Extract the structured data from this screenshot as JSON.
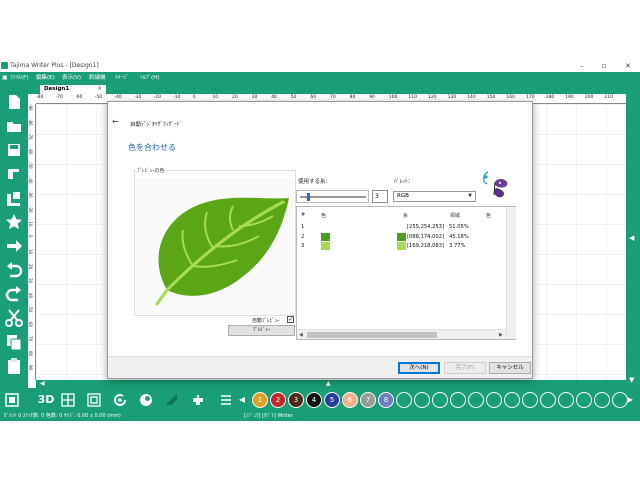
{
  "window": {
    "title": "Tajima Writer Plus - [Design1]",
    "controls": [
      "–",
      "▫",
      "✕"
    ]
  },
  "menu": {
    "items": [
      "ﾌｧｲﾙ(F)",
      "編集(E)",
      "表示(V)",
      "刺繍機",
      "ｲﾒｰｼﾞ",
      "ﾍﾙﾌﾟ(H)"
    ]
  },
  "document_tab": {
    "label": "Design1",
    "close": "✕"
  },
  "ruler": {
    "top": [
      "-80",
      "-70",
      "-60",
      "-50",
      "-40",
      "-30",
      "-20",
      "-10",
      "0",
      "10",
      "20",
      "30",
      "40",
      "50",
      "60",
      "70",
      "80",
      "90",
      "100",
      "110",
      "120",
      "130",
      "140",
      "150",
      "160",
      "170",
      "180",
      "190",
      "200",
      "210"
    ],
    "left": [
      "-90",
      "-80",
      "-70",
      "-60",
      "-50",
      "-40",
      "-30",
      "-20",
      "-10",
      "0",
      "10",
      "20",
      "30",
      "40",
      "50",
      "60",
      "70",
      "80",
      "90"
    ]
  },
  "bottom_toolbar": {
    "label_3d": "3D",
    "swatches": [
      {
        "num": "1",
        "color": "#d9a224"
      },
      {
        "num": "2",
        "color": "#c5282b"
      },
      {
        "num": "3",
        "color": "#4a2a1a"
      },
      {
        "num": "4",
        "color": "#111111"
      },
      {
        "num": "5",
        "color": "#2a3d9a"
      },
      {
        "num": "6",
        "color": "#f0b08a"
      },
      {
        "num": "7",
        "color": "#9a9a9a"
      },
      {
        "num": "8",
        "color": "#6a7fbf"
      },
      {
        "num": "",
        "color": "#1a9e78"
      },
      {
        "num": "",
        "color": "#1a9e78"
      },
      {
        "num": "",
        "color": "#1a9e78"
      },
      {
        "num": "",
        "color": "#1a9e78"
      },
      {
        "num": "",
        "color": "#1a9e78"
      },
      {
        "num": "",
        "color": "#1a9e78"
      },
      {
        "num": "",
        "color": "#1a9e78"
      },
      {
        "num": "",
        "color": "#1a9e78"
      },
      {
        "num": "",
        "color": "#1a9e78"
      },
      {
        "num": "",
        "color": "#1a9e78"
      },
      {
        "num": "",
        "color": "#1a9e78"
      },
      {
        "num": "",
        "color": "#1a9e78"
      },
      {
        "num": "",
        "color": "#1a9e78"
      }
    ]
  },
  "statusbar": {
    "left": "ｾﾞﾒﾝﾄ 0 ｽﾃｯﾁ数: 0 色数: 0 ｻｲｽﾞ: 0.00 x 0.00 (mm)",
    "right": "[ｼｼﾞｭｳ] [ﾀｼﾞﾏ] Writer"
  },
  "dialog": {
    "title": "自動ﾃﾞｼﾞﾀｲｻﾞｳｨｻﾞｰﾄﾞ",
    "heading": "色を合わせる",
    "preview_label": "ﾌﾟﾚﾋﾞｭｰの色",
    "auto_preview_label": "自動ﾌﾟﾚﾋﾞｭｰ",
    "auto_preview_checked": "✓",
    "preview_button": "ﾌﾟﾚﾋﾞｭｰ",
    "colors_label": "使用する糸：",
    "color_count": "3",
    "color_slider_fraction": 0.1,
    "palette_label": "ﾊﾟﾚｯﾄ：",
    "palette_value": "RGB",
    "table": {
      "headers": [
        "#",
        "色",
        "糸",
        "領域",
        "色"
      ],
      "rows": [
        {
          "index": "1",
          "swatch": "",
          "thread_swatch": "",
          "rgb": "[255,254,253]",
          "area": "51.05%"
        },
        {
          "index": "2",
          "swatch": "#4f9e1c",
          "thread_swatch": "#4f9e1c",
          "rgb": "[088,174,002]",
          "area": "45.18%"
        },
        {
          "index": "3",
          "swatch": "#a8da53",
          "thread_swatch": "#a8da53",
          "rgb": "[169,218,083]",
          "area": "3.77%"
        }
      ]
    },
    "buttons": {
      "next": "次へ(N)",
      "finish": "完了(F)",
      "cancel": "キャンセル"
    }
  },
  "colors": {
    "brand": "#1a9e78",
    "leaf_dark": "#5aa616",
    "leaf_light": "#a8da53"
  }
}
